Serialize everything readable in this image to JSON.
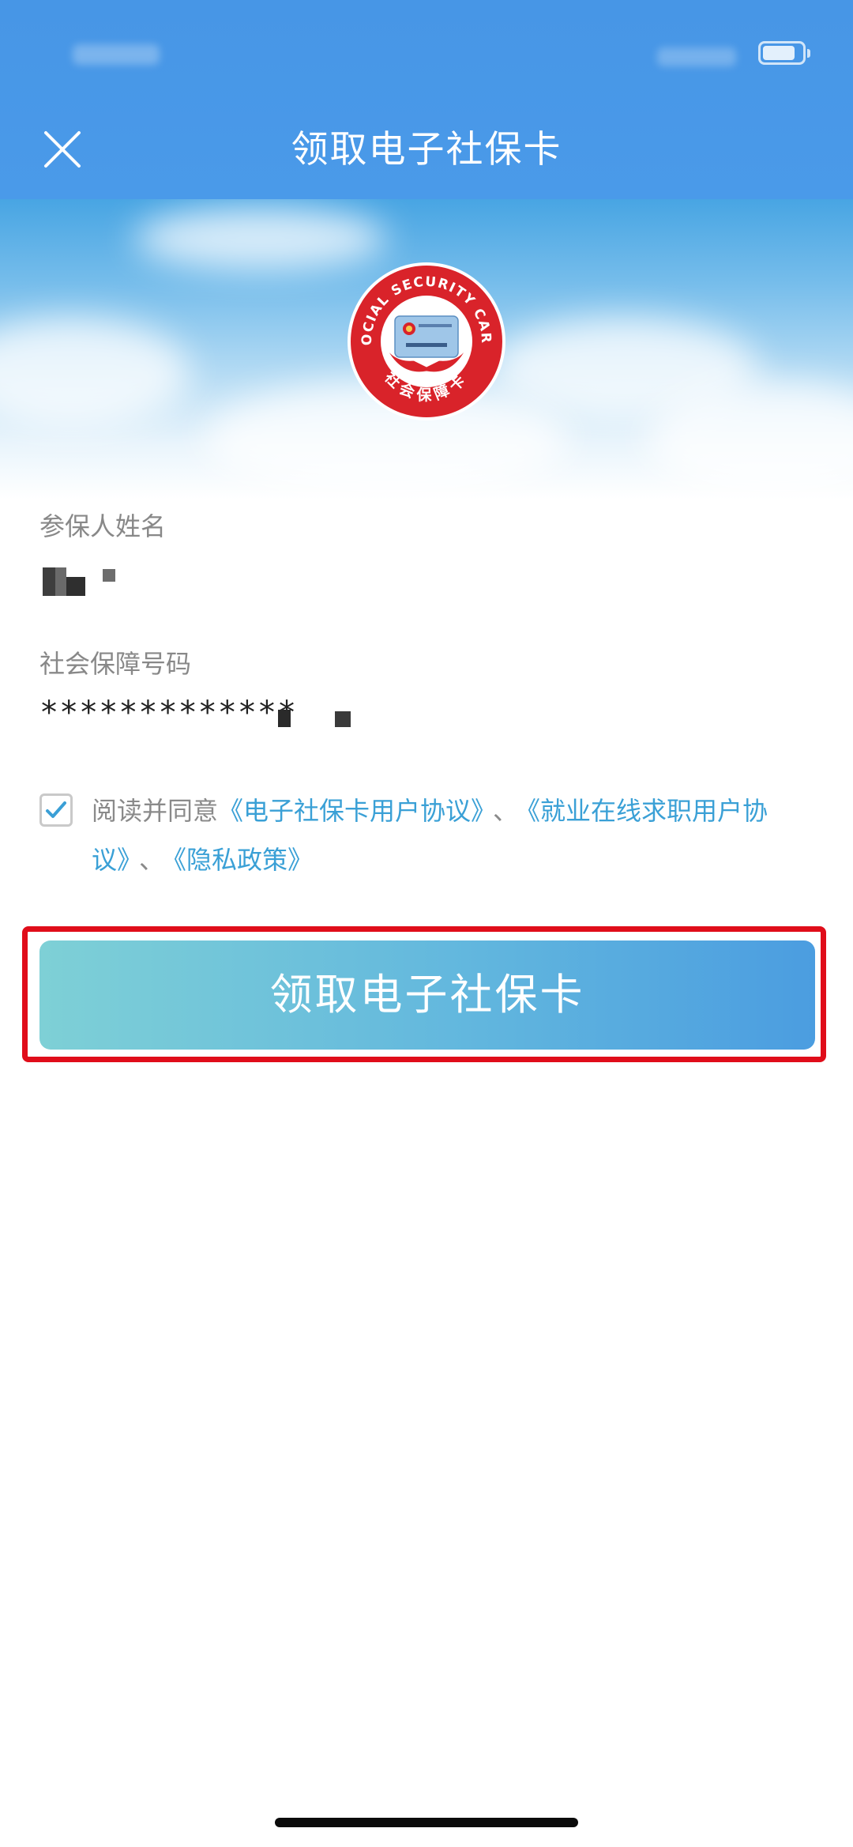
{
  "header": {
    "title": "领取电子社保卡",
    "close_icon": "close-icon"
  },
  "logo": {
    "arc_text": "SOCIAL SECURITY CARD",
    "bottom_text": "社会保障卡",
    "ring_color": "#d9232a"
  },
  "form": {
    "name_label": "参保人姓名",
    "ssn_label": "社会保障号码",
    "ssn_visible": "*************"
  },
  "agreement": {
    "checked": true,
    "prefix": "阅读并同意",
    "link1": "《电子社保卡用户协议》",
    "sep1": "、",
    "link2_part1": "《就业在线求职用户协",
    "link2_part2": "议》",
    "sep2": "、",
    "link3": "《隐私政策》"
  },
  "claim_button": {
    "label": "领取电子社保卡"
  },
  "colors": {
    "header_bg": "#4796e6",
    "link": "#3aa0d6",
    "highlight": "#e00d1a",
    "check": "#3a9fd6"
  }
}
